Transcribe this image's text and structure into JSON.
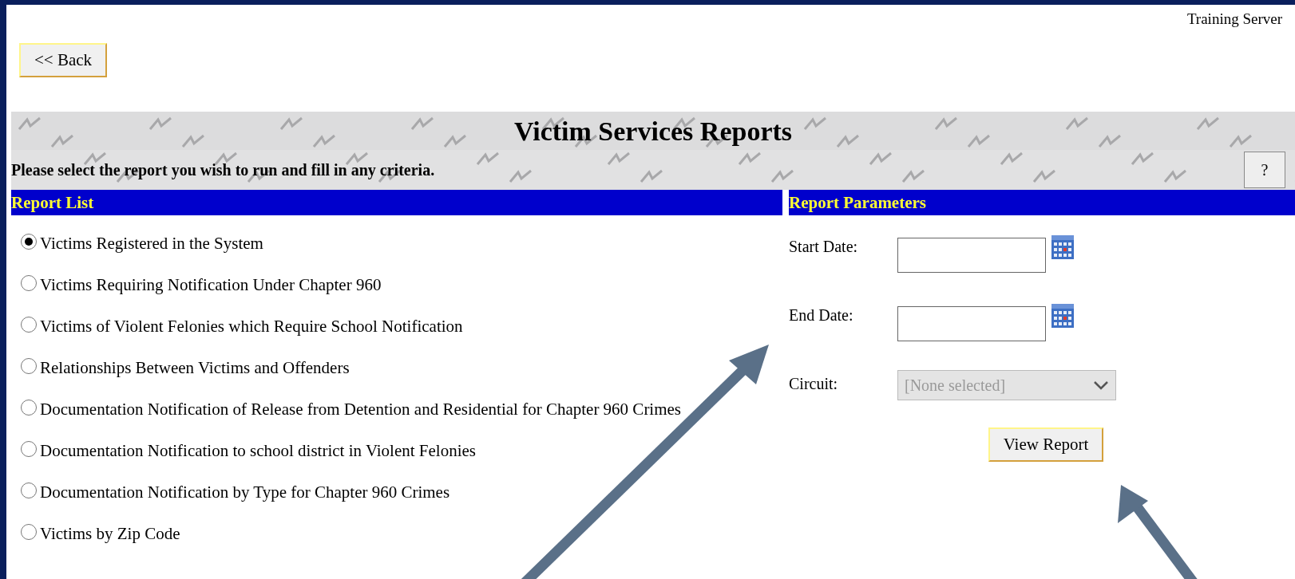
{
  "server_label": "Training Server",
  "back_button": "<< Back",
  "title": "Victim Services Reports",
  "instruction": "Please select the report you wish to run and fill in any criteria.",
  "help_button": "?",
  "report_list": {
    "heading": "Report List",
    "reports": [
      {
        "label": "Victims Registered in the System",
        "selected": true
      },
      {
        "label": "Victims Requiring Notification Under Chapter 960",
        "selected": false
      },
      {
        "label": "Victims of Violent Felonies which Require School Notification",
        "selected": false
      },
      {
        "label": "Relationships Between Victims and Offenders",
        "selected": false
      },
      {
        "label": "Documentation Notification of Release from Detention and Residential for Chapter 960 Crimes",
        "selected": false
      },
      {
        "label": "Documentation Notification to school district in Violent Felonies",
        "selected": false
      },
      {
        "label": "Documentation Notification by Type for Chapter 960 Crimes",
        "selected": false
      },
      {
        "label": "Victims by Zip Code",
        "selected": false
      }
    ]
  },
  "report_parameters": {
    "heading": "Report Parameters",
    "fields": [
      {
        "kind": "date",
        "label": "Start Date:"
      },
      {
        "kind": "date",
        "label": "End Date:"
      },
      {
        "kind": "select",
        "label": "Circuit:",
        "value": "[None selected]",
        "disabled": true
      }
    ],
    "button": "View Report"
  }
}
